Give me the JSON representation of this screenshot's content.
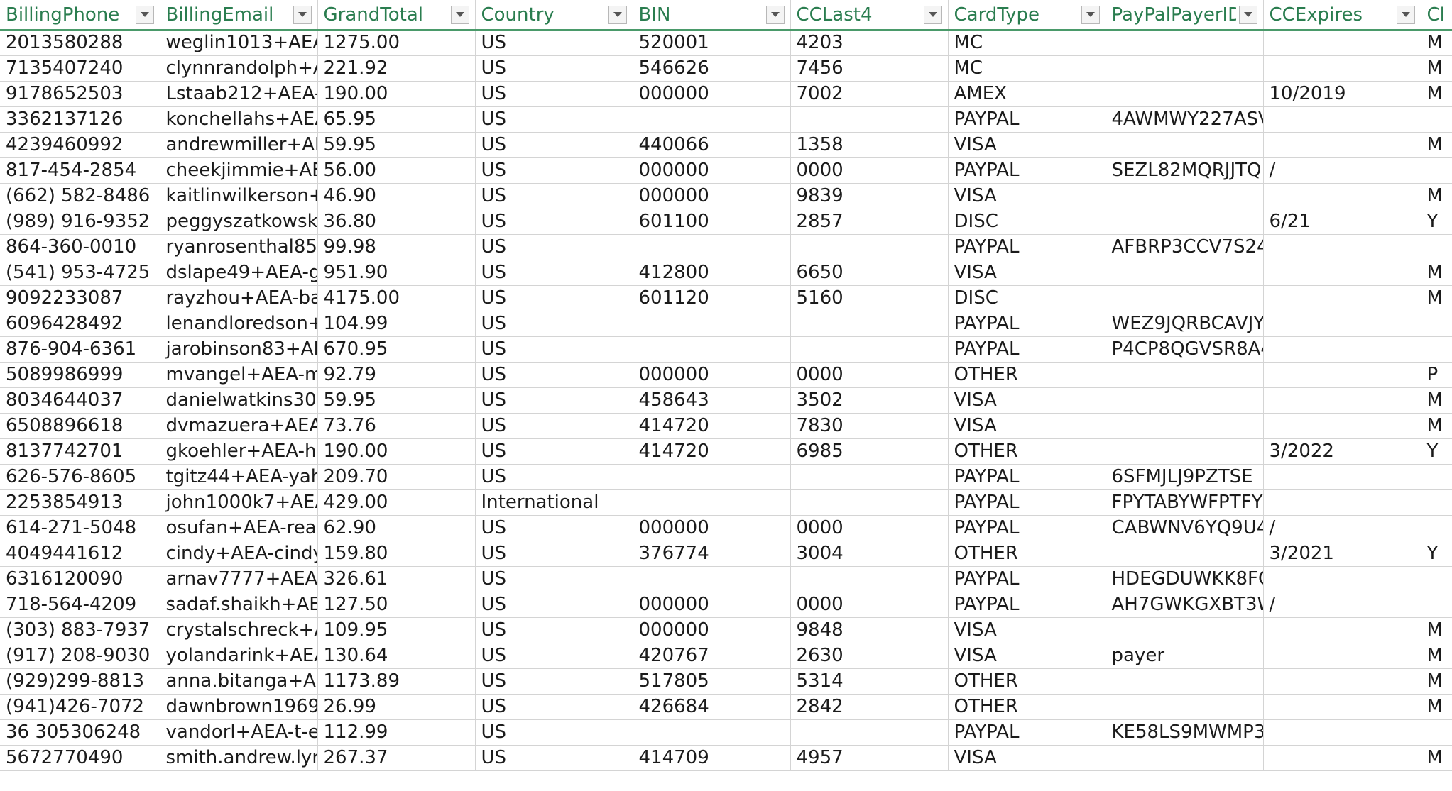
{
  "columns": [
    {
      "label": "BillingPhone",
      "key": "phone"
    },
    {
      "label": "BillingEmail",
      "key": "email"
    },
    {
      "label": "GrandTotal",
      "key": "total"
    },
    {
      "label": "Country",
      "key": "country"
    },
    {
      "label": "BIN",
      "key": "bin"
    },
    {
      "label": "CCLast4",
      "key": "last4"
    },
    {
      "label": "CardType",
      "key": "cardtype"
    },
    {
      "label": "PayPalPayerID",
      "key": "paypal"
    },
    {
      "label": "CCExpires",
      "key": "expires"
    },
    {
      "label": "Cl",
      "key": "cl"
    }
  ],
  "rows": [
    [
      "2013580288",
      "weglin1013+AEA-",
      "1275.00",
      "US",
      "520001",
      "4203",
      "MC",
      "",
      "",
      "M"
    ],
    [
      "7135407240",
      "clynnrandolph+A",
      "221.92",
      "US",
      "546626",
      "7456",
      "MC",
      "",
      "",
      "M"
    ],
    [
      "9178652503",
      "Lstaab212+AEA-a",
      "190.00",
      "US",
      "000000",
      "7002",
      "AMEX",
      "",
      "10/2019",
      "M"
    ],
    [
      "3362137126",
      "konchellahs+AEA",
      "65.95",
      "US",
      "",
      "",
      "PAYPAL",
      "4AWMWY227ASV",
      "",
      ""
    ],
    [
      "4239460992",
      "andrewmiller+AE",
      "59.95",
      "US",
      "440066",
      "1358",
      "VISA",
      "",
      "",
      "M"
    ],
    [
      "817-454-2854",
      "cheekjimmie+AEA",
      "56.00",
      "US",
      "000000",
      "0000",
      "PAYPAL",
      "SEZL82MQRJJTQ",
      "/",
      ""
    ],
    [
      "(662) 582-8486",
      "kaitlinwilkerson+",
      "46.90",
      "US",
      "000000",
      "9839",
      "VISA",
      "",
      "",
      "M"
    ],
    [
      "(989) 916-9352",
      "peggyszatkowski",
      "36.80",
      "US",
      "601100",
      "2857",
      "DISC",
      "",
      "6/21",
      "Y"
    ],
    [
      "864-360-0010",
      "ryanrosenthal85+",
      "99.98",
      "US",
      "",
      "",
      "PAYPAL",
      "AFBRP3CCV7S24",
      "",
      ""
    ],
    [
      "(541) 953-4725",
      "dslape49+AEA-g",
      "951.90",
      "US",
      "412800",
      "6650",
      "VISA",
      "",
      "",
      "M"
    ],
    [
      "9092233087",
      "rayzhou+AEA-ba",
      "4175.00",
      "US",
      "601120",
      "5160",
      "DISC",
      "",
      "",
      "M"
    ],
    [
      "6096428492",
      "lenandloredson+",
      "104.99",
      "US",
      "",
      "",
      "PAYPAL",
      "WEZ9JQRBCAVJY",
      "",
      ""
    ],
    [
      "876-904-6361",
      "jarobinson83+AE",
      "670.95",
      "US",
      "",
      "",
      "PAYPAL",
      "P4CP8QGVSR8A4",
      "",
      ""
    ],
    [
      "5089986999",
      "mvangel+AEA-m",
      "92.79",
      "US",
      "000000",
      "0000",
      "OTHER",
      "",
      "",
      "P"
    ],
    [
      "8034644037",
      "danielwatkins30+",
      "59.95",
      "US",
      "458643",
      "3502",
      "VISA",
      "",
      "",
      "M"
    ],
    [
      "6508896618",
      "dvmazuera+AEA-",
      "73.76",
      "US",
      "414720",
      "7830",
      "VISA",
      "",
      "",
      "M"
    ],
    [
      "8137742701",
      "gkoehler+AEA-he",
      "190.00",
      "US",
      "414720",
      "6985",
      "OTHER",
      "",
      "3/2022",
      "Y"
    ],
    [
      "626-576-8605",
      "tgitz44+AEA-yah",
      "209.70",
      "US",
      "",
      "",
      "PAYPAL",
      "6SFMJLJ9PZTSE",
      "",
      ""
    ],
    [
      "2253854913",
      "john1000k7+AEA",
      "429.00",
      "International",
      "",
      "",
      "PAYPAL",
      "FPYTABYWFPTFY",
      "",
      ""
    ],
    [
      "614-271-5048",
      "osufan+AEA-reag",
      "62.90",
      "US",
      "000000",
      "0000",
      "PAYPAL",
      "CABWNV6YQ9U4",
      "/",
      ""
    ],
    [
      "4049441612",
      "cindy+AEA-cindy",
      "159.80",
      "US",
      "376774",
      "3004",
      "OTHER",
      "",
      "3/2021",
      "Y"
    ],
    [
      "6316120090",
      "arnav7777+AEA-",
      "326.61",
      "US",
      "",
      "",
      "PAYPAL",
      "HDEGDUWKK8FC",
      "",
      ""
    ],
    [
      "718-564-4209",
      "sadaf.shaikh+AEA",
      "127.50",
      "US",
      "000000",
      "0000",
      "PAYPAL",
      "AH7GWKGXBT3W",
      "/",
      ""
    ],
    [
      "(303) 883-7937",
      "crystalschreck+AE",
      "109.95",
      "US",
      "000000",
      "9848",
      "VISA",
      "",
      "",
      "M"
    ],
    [
      "(917) 208-9030",
      "yolandarink+AEA",
      "130.64",
      "US",
      "420767",
      "2630",
      "VISA",
      "payer",
      "",
      "M"
    ],
    [
      "(929)299-8813",
      "anna.bitanga+AE",
      "1173.89",
      "US",
      "517805",
      "5314",
      "OTHER",
      "",
      "",
      "M"
    ],
    [
      "(941)426-7072",
      "dawnbrown1969-",
      "26.99",
      "US",
      "426684",
      "2842",
      "OTHER",
      "",
      "",
      "M"
    ],
    [
      "36 305306248",
      "vandorl+AEA-t-e",
      "112.99",
      "US",
      "",
      "",
      "PAYPAL",
      "KE58LS9MWMP3",
      "",
      ""
    ],
    [
      "5672770490",
      "smith.andrew.lynr",
      "267.37",
      "US",
      "414709",
      "4957",
      "VISA",
      "",
      "",
      "M"
    ]
  ]
}
